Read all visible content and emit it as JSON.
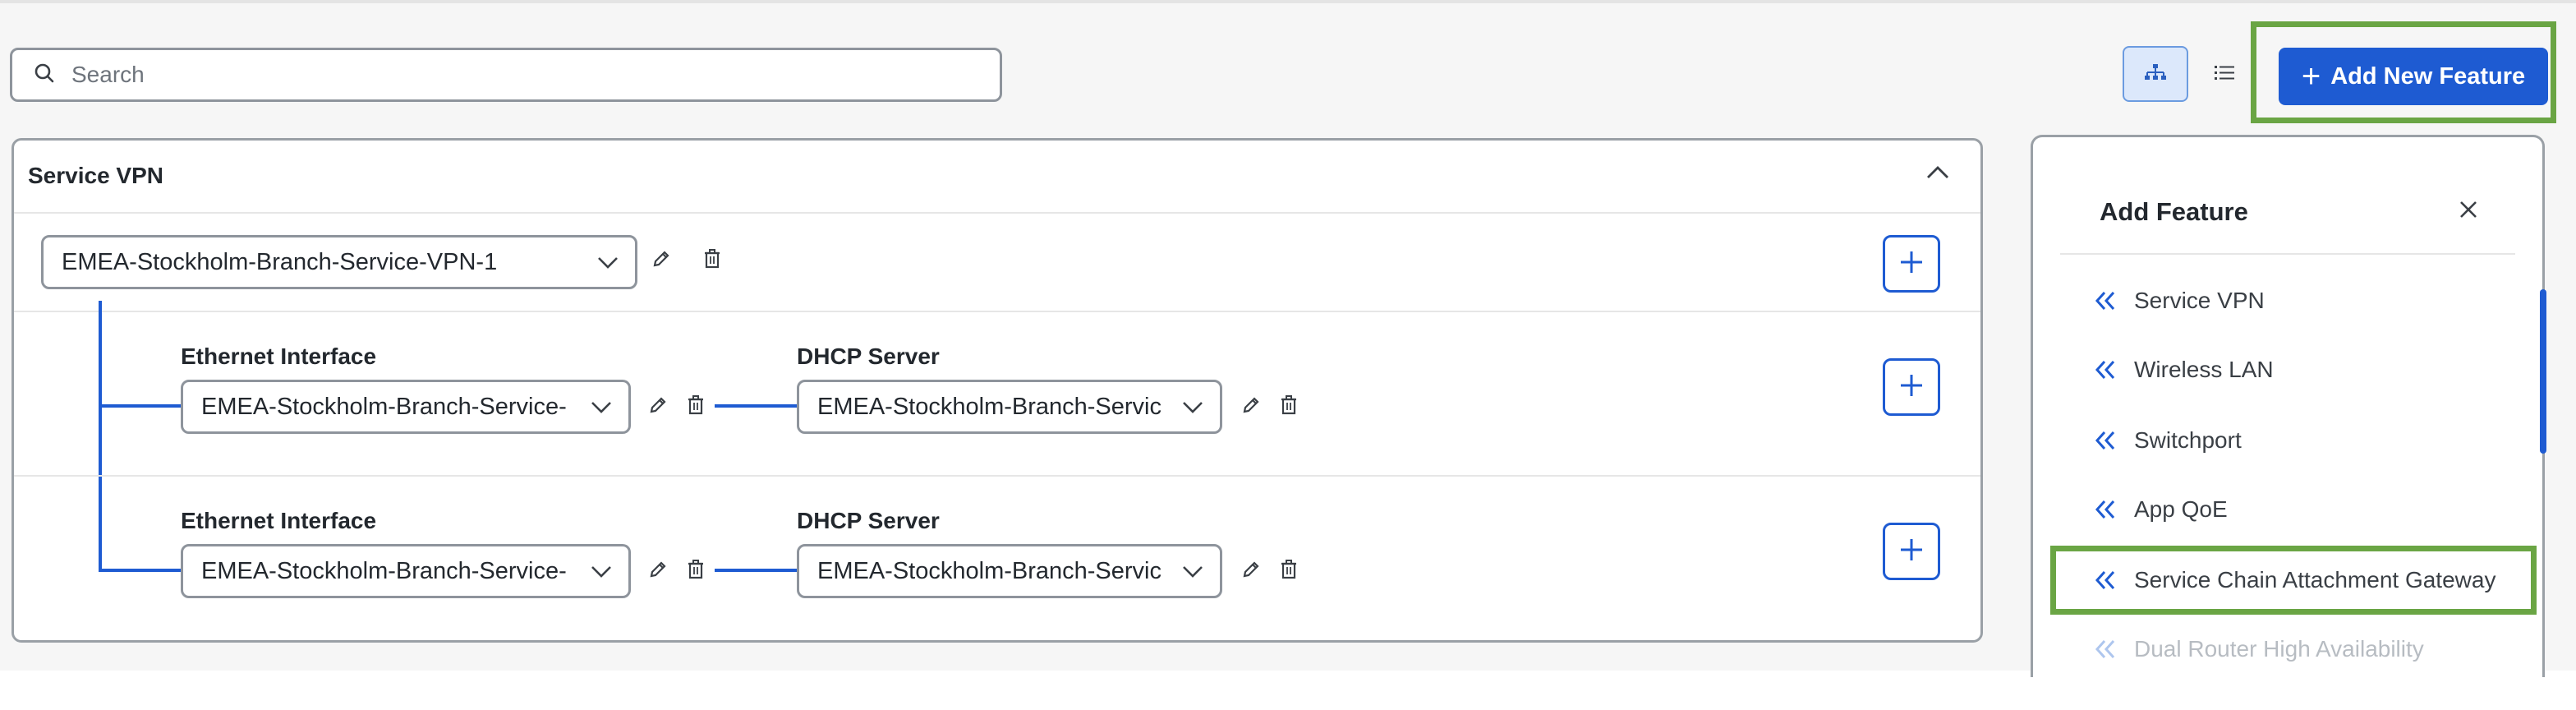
{
  "search": {
    "placeholder": "Search"
  },
  "toolbar": {
    "add_new_feature_label": "Add New Feature",
    "view_modes": [
      "hierarchy-view",
      "list-view"
    ],
    "active_view": "hierarchy-view"
  },
  "service_panel": {
    "title": "Service VPN",
    "vpn_select": "EMEA-Stockholm-Branch-Service-VPN-1",
    "rows": [
      {
        "ethernet_label": "Ethernet Interface",
        "ethernet_value": "EMEA-Stockholm-Branch-Service-",
        "dhcp_label": "DHCP Server",
        "dhcp_value": "EMEA-Stockholm-Branch-Servic"
      },
      {
        "ethernet_label": "Ethernet Interface",
        "ethernet_value": "EMEA-Stockholm-Branch-Service-",
        "dhcp_label": "DHCP Server",
        "dhcp_value": "EMEA-Stockholm-Branch-Servic"
      }
    ]
  },
  "add_feature_panel": {
    "title": "Add Feature",
    "items": [
      {
        "label": "Service VPN",
        "enabled": true
      },
      {
        "label": "Wireless LAN",
        "enabled": true
      },
      {
        "label": "Switchport",
        "enabled": true
      },
      {
        "label": "App QoE",
        "enabled": true
      },
      {
        "label": "Service Chain Attachment Gateway",
        "enabled": true
      },
      {
        "label": "Dual Router High Availability",
        "enabled": false
      }
    ]
  },
  "colors": {
    "accent": "#1e5bd2",
    "highlight": "#6aa544",
    "border": "#8e949c",
    "disabled_text": "#b7bcc2"
  }
}
